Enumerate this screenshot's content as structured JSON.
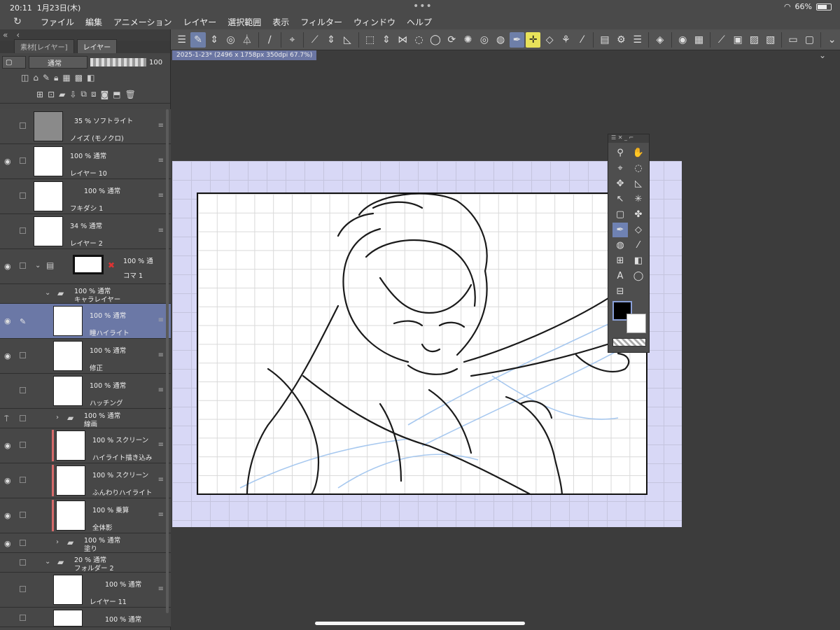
{
  "status": {
    "time": "20:11",
    "date": "1月23日(木)",
    "battery": "66%",
    "more": "•••"
  },
  "menubar": {
    "items": [
      "ファイル",
      "編集",
      "アニメーション",
      "レイヤー",
      "選択範囲",
      "表示",
      "フィルター",
      "ウィンドウ",
      "ヘルプ"
    ]
  },
  "panel": {
    "tabs": [
      "素材[レイヤー]",
      "レイヤー"
    ],
    "blend_mode": "通常",
    "opacity": "100"
  },
  "document": {
    "tab_label": "2025-1-23* (2496 x 1758px 350dpi 67.7%)"
  },
  "layers": [
    {
      "mode": "35 % ソフトライト",
      "name": "ノイズ (モノクロ)",
      "visible": false
    },
    {
      "mode": "100 % 通常",
      "name": "レイヤー 10",
      "visible": true
    },
    {
      "mode": "100 % 通常",
      "name": "フキダシ 1",
      "visible": false
    },
    {
      "mode": "34 % 通常",
      "name": "レイヤー 2",
      "visible": false
    },
    {
      "mode": "100 % 通",
      "name": "コマ 1",
      "visible": true
    },
    {
      "mode": "100 % 通常",
      "name": "キャラレイヤー",
      "visible": true,
      "folder": true
    },
    {
      "mode": "100 % 通常",
      "name": "瞳ハイライト",
      "visible": true,
      "active": true
    },
    {
      "mode": "100 % 通常",
      "name": "修正",
      "visible": true
    },
    {
      "mode": "100 % 通常",
      "name": "ハッチング",
      "visible": false
    },
    {
      "mode": "100 % 通常",
      "name": "線画",
      "visible": false,
      "folder": true
    },
    {
      "mode": "100 % スクリーン",
      "name": "ハイライト描き込み",
      "visible": true
    },
    {
      "mode": "100 % スクリーン",
      "name": "ふんわりハイライト",
      "visible": true
    },
    {
      "mode": "100 % 乗算",
      "name": "全体影",
      "visible": true
    },
    {
      "mode": "100 % 通常",
      "name": "塗り",
      "visible": true,
      "folder": true
    },
    {
      "mode": "20 % 通常",
      "name": "フォルダー 2",
      "visible": false,
      "folder": true
    },
    {
      "mode": "100 % 通常",
      "name": "レイヤー 11",
      "visible": false
    },
    {
      "mode": "100 % 通常",
      "name": "",
      "visible": false
    }
  ],
  "colors": {
    "accent": "#6b78a6",
    "canvas_bg": "#d8d8f6",
    "highlight": "#d46a6a"
  }
}
